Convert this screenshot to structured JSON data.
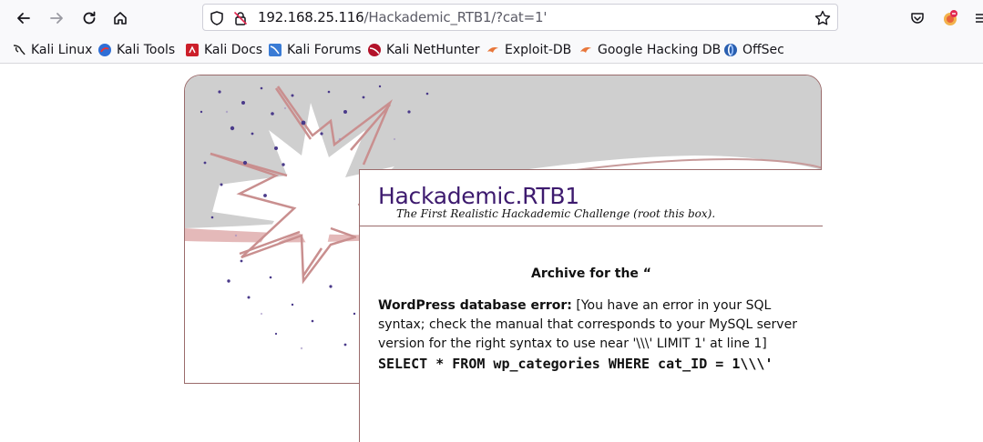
{
  "browser": {
    "url_host": "192.168.25.116",
    "url_path": "/Hackademic_RTB1/?cat=1'",
    "bookmarks": [
      {
        "label": "Kali Linux",
        "icon": "kali-dragon-icon"
      },
      {
        "label": "Kali Tools",
        "icon": "kali-tools-icon"
      },
      {
        "label": "Kali Docs",
        "icon": "kali-docs-icon"
      },
      {
        "label": "Kali Forums",
        "icon": "kali-forums-icon"
      },
      {
        "label": "Kali NetHunter",
        "icon": "kali-nethunter-icon"
      },
      {
        "label": "Exploit-DB",
        "icon": "exploit-db-icon"
      },
      {
        "label": "Google Hacking DB",
        "icon": "ghdb-icon"
      },
      {
        "label": "OffSec",
        "icon": "offsec-icon"
      }
    ]
  },
  "blog": {
    "title": "Hackademic.RTB1",
    "description": "The First Realistic Hackademic Challenge (root this box)."
  },
  "main": {
    "archive_heading": "Archive for the  “",
    "db_error_label": "WordPress database error:",
    "db_error_message": " [You have an error in your SQL syntax; check the manual that corresponds to your MySQL server version for the right syntax to use near '\\\\\\' LIMIT 1' at line 1]",
    "sql_query": "SELECT * FROM wp_categories WHERE cat_ID = 1\\\\\\'"
  },
  "colors": {
    "title": "#3d1a6e",
    "frame_border": "#9a6b6b",
    "header_gray": "#cfcfcf"
  }
}
